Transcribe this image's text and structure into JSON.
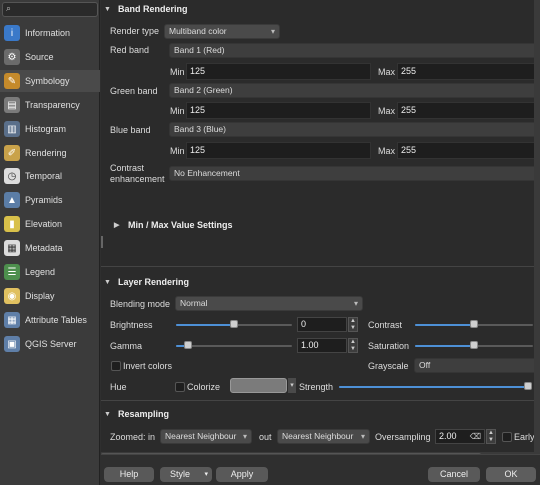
{
  "sidebar": {
    "items": [
      {
        "label": "Information",
        "icon": "info-icon",
        "color": "#3a79c9",
        "glyph": "i"
      },
      {
        "label": "Source",
        "icon": "wrench-icon",
        "color": "#6b6b6b",
        "glyph": "⚙"
      },
      {
        "label": "Symbology",
        "icon": "brush-icon",
        "color": "#c58a2b",
        "glyph": "✎"
      },
      {
        "label": "Transparency",
        "icon": "transparency-icon",
        "color": "#7a7a7a",
        "glyph": "▤"
      },
      {
        "label": "Histogram",
        "icon": "histogram-icon",
        "color": "#5a6f8a",
        "glyph": "▥"
      },
      {
        "label": "Rendering",
        "icon": "rendering-brush-icon",
        "color": "#c9a24a",
        "glyph": "✐"
      },
      {
        "label": "Temporal",
        "icon": "clock-icon",
        "color": "#dcdcdc",
        "glyph": "◷"
      },
      {
        "label": "Pyramids",
        "icon": "pyramids-icon",
        "color": "#5b7da6",
        "glyph": "▲"
      },
      {
        "label": "Elevation",
        "icon": "elevation-icon",
        "color": "#d8c04a",
        "glyph": "▮"
      },
      {
        "label": "Metadata",
        "icon": "metadata-icon",
        "color": "#dcdcdc",
        "glyph": "▦"
      },
      {
        "label": "Legend",
        "icon": "legend-icon",
        "color": "#4d8f4d",
        "glyph": "☰"
      },
      {
        "label": "Display",
        "icon": "display-bubble-icon",
        "color": "#e0c060",
        "glyph": "◉"
      },
      {
        "label": "Attribute Tables",
        "icon": "table-icon",
        "color": "#5f7fa8",
        "glyph": "▦"
      },
      {
        "label": "QGIS Server",
        "icon": "server-icon",
        "color": "#5f7fa8",
        "glyph": "▣"
      }
    ]
  },
  "band_rendering": {
    "title": "Band Rendering",
    "render_type_label": "Render type",
    "render_type_value": "Multiband color",
    "red_label": "Red band",
    "red_value": "Band 1 (Red)",
    "green_label": "Green band",
    "green_value": "Band 2 (Green)",
    "blue_label": "Blue band",
    "blue_value": "Band 3 (Blue)",
    "min_label": "Min",
    "max_label": "Max",
    "red_min": "125",
    "red_max": "255",
    "green_min": "125",
    "green_max": "255",
    "blue_min": "125",
    "blue_max": "255",
    "contrast_label_1": "Contrast",
    "contrast_label_2": "enhancement",
    "contrast_value": "No Enhancement",
    "minmax_title": "Min / Max Value Settings"
  },
  "layer_rendering": {
    "title": "Layer Rendering",
    "blending_label": "Blending mode",
    "blending_value": "Normal",
    "brightness_label": "Brightness",
    "brightness_value": "0",
    "brightness_level": 0.5,
    "contrast_label": "Contrast",
    "contrast_level": 0.5,
    "gamma_label": "Gamma",
    "gamma_value": "1.00",
    "gamma_level": 0.1,
    "saturation_label": "Saturation",
    "saturation_level": 0.5,
    "invert_label": "Invert colors",
    "grayscale_label": "Grayscale",
    "grayscale_value": "Off",
    "hue_label": "Hue",
    "colorize_label": "Colorize",
    "strength_label": "Strength",
    "strength_level": 1.0
  },
  "resampling": {
    "title": "Resampling",
    "zoomed_in_label": "Zoomed: in",
    "zoomed_in_value": "Nearest Neighbour",
    "out_label": "out",
    "out_value": "Nearest Neighbour",
    "oversampling_label": "Oversampling",
    "oversampling_value": "2.00",
    "early_label": "Early r"
  },
  "footer": {
    "help": "Help",
    "style": "Style",
    "apply": "Apply",
    "cancel": "Cancel",
    "ok": "OK"
  }
}
